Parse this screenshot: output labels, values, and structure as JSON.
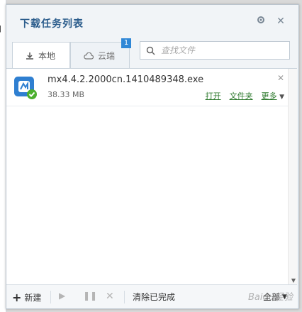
{
  "window": {
    "title": "下载任务列表",
    "settings_icon": "gear-icon",
    "close_icon": "close-icon"
  },
  "tabs": [
    {
      "label": "本地",
      "icon": "download-icon"
    },
    {
      "label": "云端",
      "icon": "cloud-icon",
      "badge": "1"
    }
  ],
  "search": {
    "placeholder": "查找文件"
  },
  "downloads": [
    {
      "name": "mx4.4.2.2000cn.1410489348.exe",
      "size": "38.33 MB",
      "actions": {
        "open": "打开",
        "folder": "文件夹",
        "more": "更多"
      }
    }
  ],
  "bottom": {
    "new_label": "新建",
    "clear_label": "清除已完成",
    "filter_label": "全部"
  },
  "colors": {
    "accent": "#2c5d8c",
    "link": "#2e7a2e",
    "badge": "#2f87d6"
  },
  "watermark": "Baidu经验"
}
